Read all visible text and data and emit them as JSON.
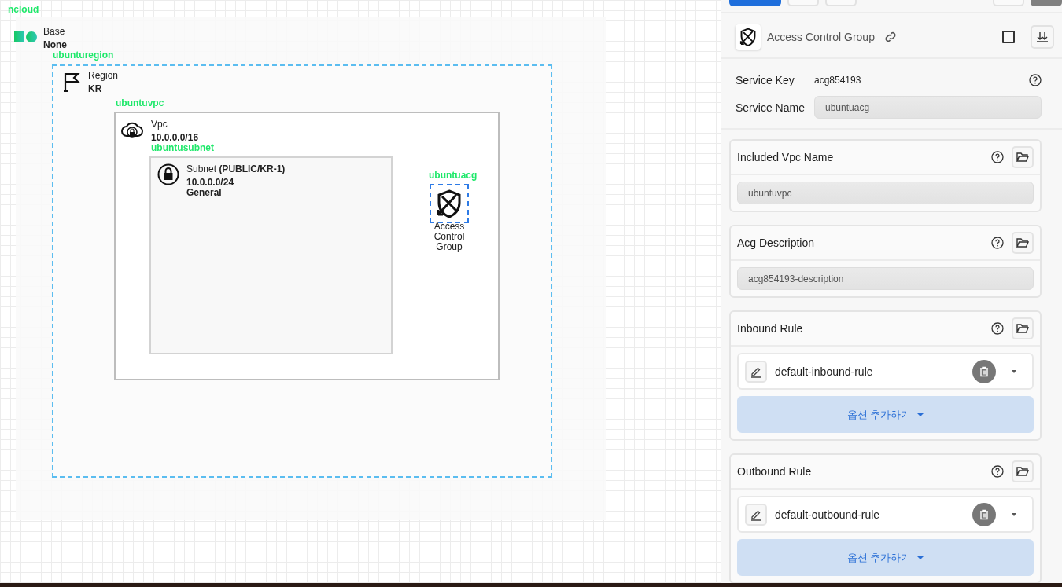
{
  "canvas": {
    "root_label": "ncloud",
    "base": {
      "title": "Base",
      "value": "None"
    },
    "region": {
      "label": "ubunturegion",
      "title": "Region",
      "value": "KR"
    },
    "vpc": {
      "label": "ubuntuvpc",
      "title": "Vpc",
      "value": "10.0.0.0/16"
    },
    "subnet": {
      "label": "ubuntusubnet",
      "title": "Subnet **(PUBLIC/KR-1)**",
      "cidr": "10.0.0.0/24",
      "type": "General"
    },
    "acg": {
      "label": "ubuntuacg",
      "title": "Access Control Group",
      "selected": true
    }
  },
  "panel": {
    "title": "Access Control Group",
    "checked": false,
    "service_key": {
      "label": "Service Key",
      "value": "acg854193"
    },
    "service_name": {
      "label": "Service Name",
      "value": "ubuntuacg"
    },
    "sections": [
      {
        "kind": "field",
        "title": "Included Vpc Name",
        "value": "ubuntuvpc"
      },
      {
        "kind": "field",
        "title": "Acg Description",
        "value": "acg854193-description"
      },
      {
        "kind": "rules",
        "title": "Inbound Rule",
        "rules": [
          "default-inbound-rule"
        ],
        "add_label": "옵션 추가하기"
      },
      {
        "kind": "rules",
        "title": "Outbound Rule",
        "rules": [
          "default-outbound-rule"
        ],
        "add_label": "옵션 추가하기"
      }
    ]
  }
}
